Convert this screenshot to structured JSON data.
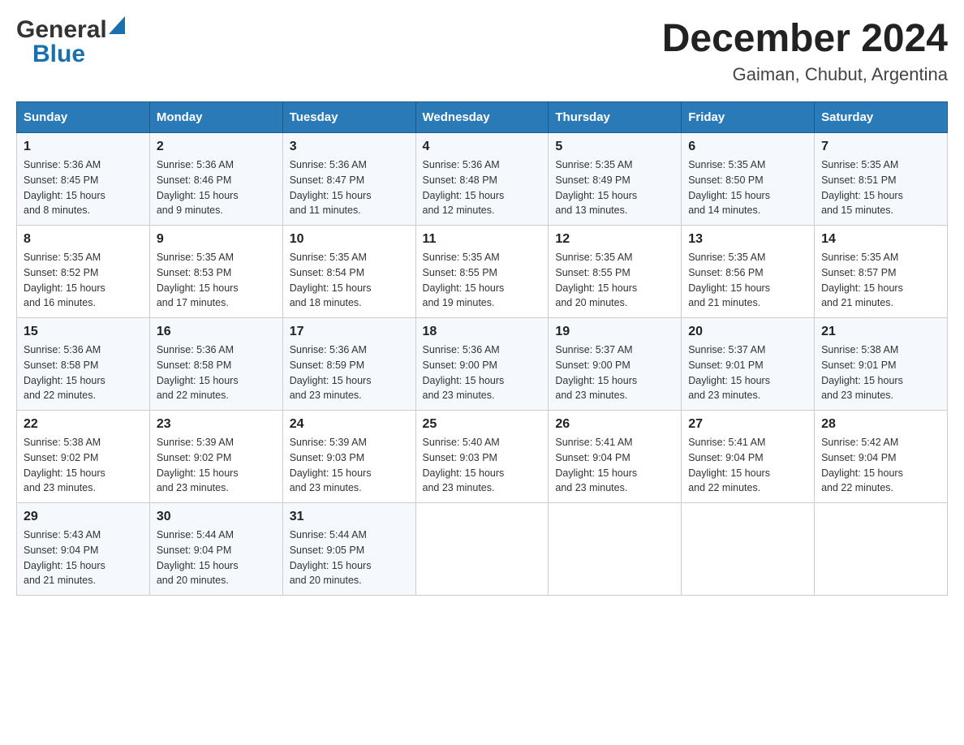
{
  "logo": {
    "general": "General",
    "blue": "Blue"
  },
  "title": "December 2024",
  "subtitle": "Gaiman, Chubut, Argentina",
  "weekdays": [
    "Sunday",
    "Monday",
    "Tuesday",
    "Wednesday",
    "Thursday",
    "Friday",
    "Saturday"
  ],
  "weeks": [
    [
      {
        "day": "1",
        "sunrise": "5:36 AM",
        "sunset": "8:45 PM",
        "daylight": "15 hours and 8 minutes."
      },
      {
        "day": "2",
        "sunrise": "5:36 AM",
        "sunset": "8:46 PM",
        "daylight": "15 hours and 9 minutes."
      },
      {
        "day": "3",
        "sunrise": "5:36 AM",
        "sunset": "8:47 PM",
        "daylight": "15 hours and 11 minutes."
      },
      {
        "day": "4",
        "sunrise": "5:36 AM",
        "sunset": "8:48 PM",
        "daylight": "15 hours and 12 minutes."
      },
      {
        "day": "5",
        "sunrise": "5:35 AM",
        "sunset": "8:49 PM",
        "daylight": "15 hours and 13 minutes."
      },
      {
        "day": "6",
        "sunrise": "5:35 AM",
        "sunset": "8:50 PM",
        "daylight": "15 hours and 14 minutes."
      },
      {
        "day": "7",
        "sunrise": "5:35 AM",
        "sunset": "8:51 PM",
        "daylight": "15 hours and 15 minutes."
      }
    ],
    [
      {
        "day": "8",
        "sunrise": "5:35 AM",
        "sunset": "8:52 PM",
        "daylight": "15 hours and 16 minutes."
      },
      {
        "day": "9",
        "sunrise": "5:35 AM",
        "sunset": "8:53 PM",
        "daylight": "15 hours and 17 minutes."
      },
      {
        "day": "10",
        "sunrise": "5:35 AM",
        "sunset": "8:54 PM",
        "daylight": "15 hours and 18 minutes."
      },
      {
        "day": "11",
        "sunrise": "5:35 AM",
        "sunset": "8:55 PM",
        "daylight": "15 hours and 19 minutes."
      },
      {
        "day": "12",
        "sunrise": "5:35 AM",
        "sunset": "8:55 PM",
        "daylight": "15 hours and 20 minutes."
      },
      {
        "day": "13",
        "sunrise": "5:35 AM",
        "sunset": "8:56 PM",
        "daylight": "15 hours and 21 minutes."
      },
      {
        "day": "14",
        "sunrise": "5:35 AM",
        "sunset": "8:57 PM",
        "daylight": "15 hours and 21 minutes."
      }
    ],
    [
      {
        "day": "15",
        "sunrise": "5:36 AM",
        "sunset": "8:58 PM",
        "daylight": "15 hours and 22 minutes."
      },
      {
        "day": "16",
        "sunrise": "5:36 AM",
        "sunset": "8:58 PM",
        "daylight": "15 hours and 22 minutes."
      },
      {
        "day": "17",
        "sunrise": "5:36 AM",
        "sunset": "8:59 PM",
        "daylight": "15 hours and 23 minutes."
      },
      {
        "day": "18",
        "sunrise": "5:36 AM",
        "sunset": "9:00 PM",
        "daylight": "15 hours and 23 minutes."
      },
      {
        "day": "19",
        "sunrise": "5:37 AM",
        "sunset": "9:00 PM",
        "daylight": "15 hours and 23 minutes."
      },
      {
        "day": "20",
        "sunrise": "5:37 AM",
        "sunset": "9:01 PM",
        "daylight": "15 hours and 23 minutes."
      },
      {
        "day": "21",
        "sunrise": "5:38 AM",
        "sunset": "9:01 PM",
        "daylight": "15 hours and 23 minutes."
      }
    ],
    [
      {
        "day": "22",
        "sunrise": "5:38 AM",
        "sunset": "9:02 PM",
        "daylight": "15 hours and 23 minutes."
      },
      {
        "day": "23",
        "sunrise": "5:39 AM",
        "sunset": "9:02 PM",
        "daylight": "15 hours and 23 minutes."
      },
      {
        "day": "24",
        "sunrise": "5:39 AM",
        "sunset": "9:03 PM",
        "daylight": "15 hours and 23 minutes."
      },
      {
        "day": "25",
        "sunrise": "5:40 AM",
        "sunset": "9:03 PM",
        "daylight": "15 hours and 23 minutes."
      },
      {
        "day": "26",
        "sunrise": "5:41 AM",
        "sunset": "9:04 PM",
        "daylight": "15 hours and 23 minutes."
      },
      {
        "day": "27",
        "sunrise": "5:41 AM",
        "sunset": "9:04 PM",
        "daylight": "15 hours and 22 minutes."
      },
      {
        "day": "28",
        "sunrise": "5:42 AM",
        "sunset": "9:04 PM",
        "daylight": "15 hours and 22 minutes."
      }
    ],
    [
      {
        "day": "29",
        "sunrise": "5:43 AM",
        "sunset": "9:04 PM",
        "daylight": "15 hours and 21 minutes."
      },
      {
        "day": "30",
        "sunrise": "5:44 AM",
        "sunset": "9:04 PM",
        "daylight": "15 hours and 20 minutes."
      },
      {
        "day": "31",
        "sunrise": "5:44 AM",
        "sunset": "9:05 PM",
        "daylight": "15 hours and 20 minutes."
      },
      null,
      null,
      null,
      null
    ]
  ],
  "labels": {
    "sunrise": "Sunrise:",
    "sunset": "Sunset:",
    "daylight": "Daylight:"
  }
}
